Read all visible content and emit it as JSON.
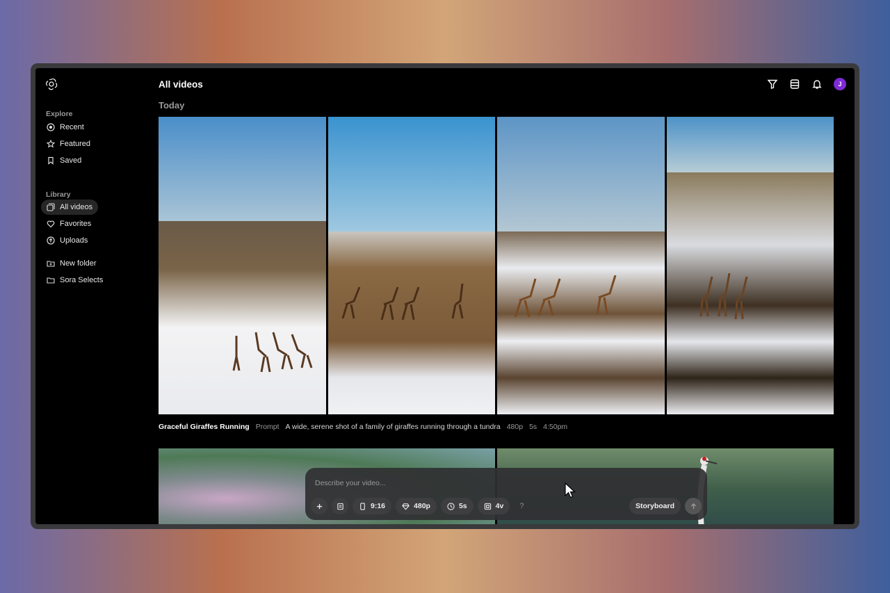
{
  "sidebar": {
    "explore_label": "Explore",
    "explore_items": [
      {
        "label": "Recent",
        "icon": "clock-icon"
      },
      {
        "label": "Featured",
        "icon": "star-icon"
      },
      {
        "label": "Saved",
        "icon": "bookmark-icon"
      }
    ],
    "library_label": "Library",
    "library_items": [
      {
        "label": "All videos",
        "icon": "videos-icon",
        "active": true
      },
      {
        "label": "Favorites",
        "icon": "heart-icon"
      },
      {
        "label": "Uploads",
        "icon": "upload-icon"
      }
    ],
    "folder_items": [
      {
        "label": "New folder",
        "icon": "new-folder-icon"
      },
      {
        "label": "Sora Selects",
        "icon": "folder-icon"
      }
    ]
  },
  "header": {
    "title": "All videos",
    "avatar_initial": "J"
  },
  "group": {
    "label": "Today",
    "video_title": "Graceful Giraffes Running",
    "prompt_label": "Prompt",
    "prompt_text": "A wide, serene shot of a family of giraffes running through a tundra",
    "resolution": "480p",
    "duration": "5s",
    "time": "4:50pm"
  },
  "composer": {
    "placeholder": "Describe your video...",
    "aspect": "9:16",
    "resolution": "480p",
    "duration": "5s",
    "variations": "4v",
    "help": "?",
    "storyboard_label": "Storyboard"
  },
  "colors": {
    "avatar": "#7e2bd6",
    "background": "#000000"
  }
}
